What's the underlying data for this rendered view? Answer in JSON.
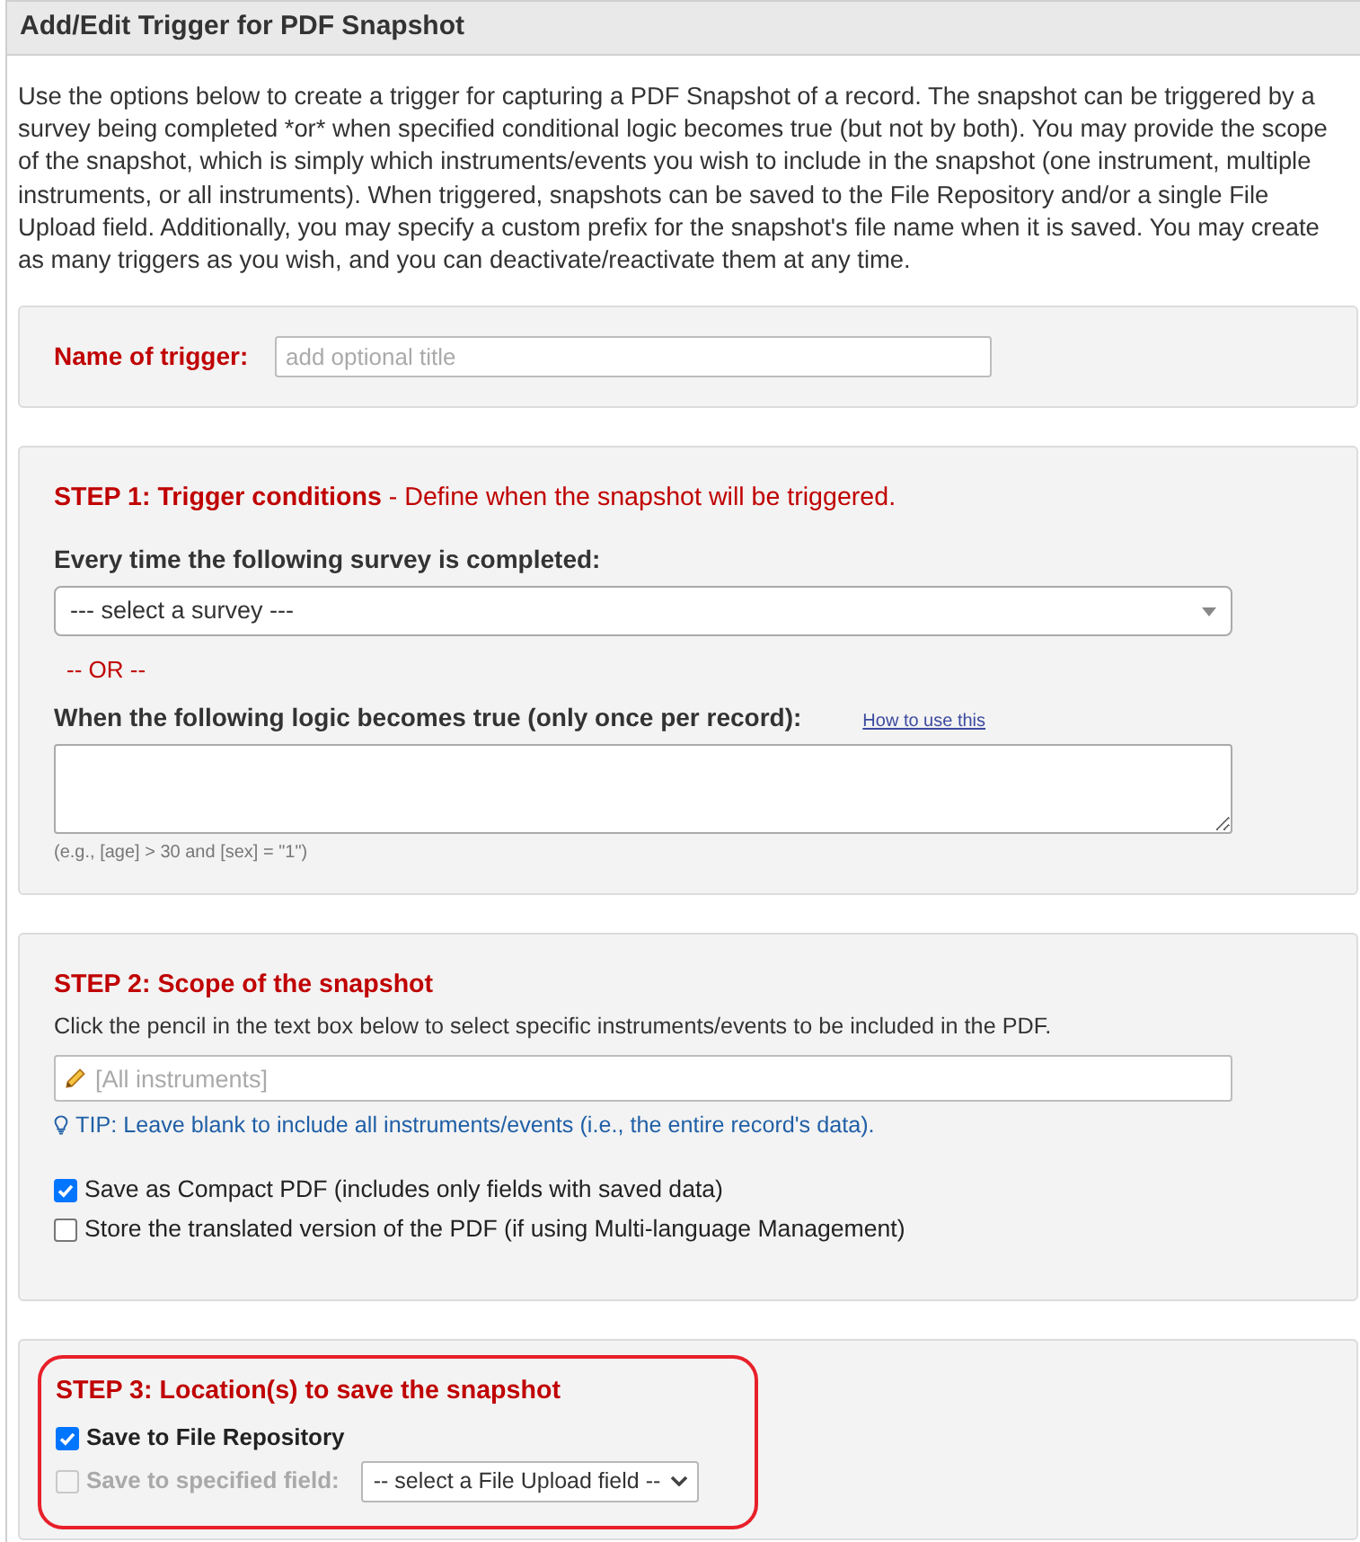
{
  "dialog": {
    "title": "Add/Edit Trigger for PDF Snapshot"
  },
  "intro": "Use the options below to create a trigger for capturing a PDF Snapshot of a record. The snapshot can be triggered by a survey being completed *or* when specified conditional logic becomes true (but not by both). You may provide the scope of the snapshot, which is simply which instruments/events you wish to include in the snapshot (one instrument, multiple instruments, or all instruments). When triggered, snapshots can be saved to the File Repository and/or a single File Upload field. Additionally, you may specify a custom prefix for the snapshot's file name when it is saved. You may create as many triggers as you wish, and you can deactivate/reactivate them at any time.",
  "name_section": {
    "label": "Name of trigger:",
    "input": {
      "placeholder": "add optional title"
    }
  },
  "step1": {
    "heading": "**STEP 1: Trigger conditions** - Define when the snapshot will be triggered.",
    "survey_label": "Every time the following survey is completed:",
    "survey_select": {
      "value": "--- select a survey ---"
    },
    "separator": "-- OR --",
    "logic_label": "When the following logic becomes true (only once per record):",
    "help_link": "How to use this",
    "logic_hint": "(e.g., [age] > 30 and [sex] = \"1\")"
  },
  "step2": {
    "heading": "STEP 2: Scope of the snapshot",
    "description": "Click the pencil in the text box below to select specific instruments/events to be included in the PDF.",
    "scope_input": {
      "placeholder": "[All instruments]"
    },
    "tip": "TIP: Leave blank to include all instruments/events (i.e., the entire record's data).",
    "options": [
      {
        "label": "Save as Compact PDF (includes only fields with saved data)",
        "checked": true
      },
      {
        "label": "Store the translated version of the PDF (if using Multi-language Management)",
        "checked": false
      }
    ]
  },
  "step3": {
    "heading": "STEP 3: Location(s) to save the snapshot",
    "highlighted": true,
    "options": [
      {
        "kind": "checkbox",
        "label": "Save to File Repository",
        "checked": true,
        "disabled": false
      },
      {
        "kind": "checkbox_select",
        "label": "Save to specified field:",
        "checked": false,
        "disabled": true,
        "select": {
          "value": "-- select a File Upload field --"
        }
      }
    ]
  }
}
